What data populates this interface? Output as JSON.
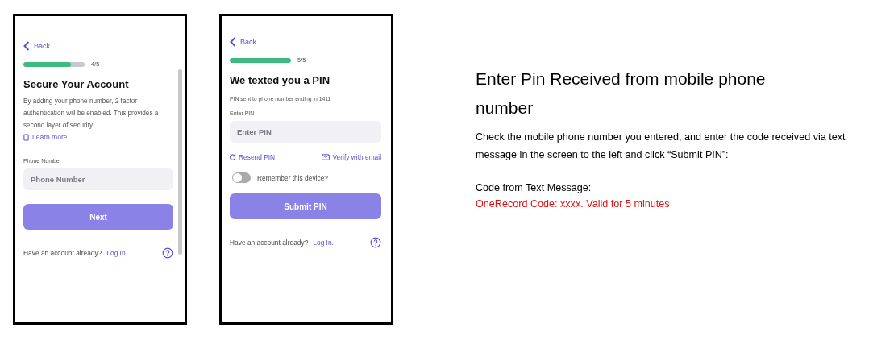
{
  "phones": [
    {
      "back": "Back",
      "progress": {
        "level": 0.78
      },
      "step": "4/5",
      "title": "Secure Your Account",
      "description": "By adding your phone number, 2 factor authentication will be enabled. This provides a second layer of security.",
      "learn_more": "Learn more",
      "field_label": "Phone Number",
      "field_placeholder": "Phone Number",
      "button": {
        "label": "Next",
        "disabled": true
      },
      "footer_text": "Have an account already?",
      "footer_link": "Log In."
    },
    {
      "back": "Back",
      "progress": {
        "level": 1
      },
      "step": "5/5",
      "title": "We texted you a PIN",
      "note": "PIN sent to phone number ending in 1411",
      "field_label": "Enter PIN",
      "field_placeholder": "Enter PIN",
      "links": [
        "Resend PIN",
        "Verify with email"
      ],
      "toggle": {
        "label": "Remember this device?",
        "on": false
      },
      "button": {
        "label": "Submit PIN",
        "disabled": true
      },
      "footer_text": "Have an account already?",
      "footer_link": "Log In."
    }
  ],
  "instructions": {
    "title": "Enter Pin Received from mobile phone number",
    "body": "Check the mobile phone number you entered, and enter the code received via text message in the screen to the left and click “Submit PIN”:",
    "code_label": "Code from Text Message:",
    "code_message": "OneRecord Code: xxxx. Valid for 5 minutes"
  }
}
